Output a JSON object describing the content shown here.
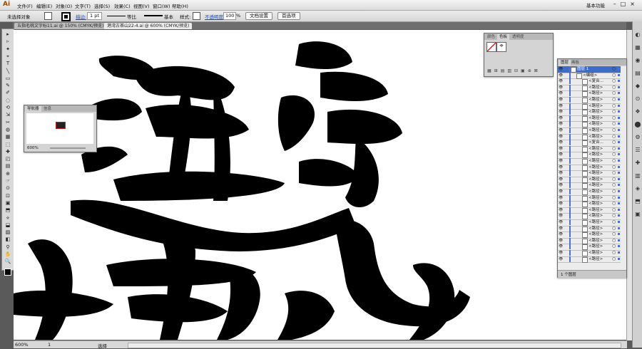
{
  "app": {
    "logo": "Ai",
    "workspace": "基本功能",
    "window_controls": [
      "–",
      "□",
      "×"
    ]
  },
  "menu": [
    "文件(F)",
    "编辑(E)",
    "对象(O)",
    "文字(T)",
    "选择(S)",
    "效果(C)",
    "视图(V)",
    "窗口(W)",
    "帮助(H)"
  ],
  "control_bar": {
    "selection": "未选择对象",
    "stroke_label": "描边:",
    "stroke_value": "1 pt",
    "profile_label": "等比",
    "brush_label": "基本",
    "style_label": "样式:",
    "opacity_label": "不透明度:",
    "opacity_value": "100",
    "opacity_unit": "%",
    "doc_setup": "文档设置",
    "preferences": "首选项"
  },
  "tabs": [
    {
      "label": "五指毛桃文字标11.ai @ 150% (CMYK/预览)",
      "active": false
    },
    {
      "label": "港湾古茶山22-4.ai @ 600% (CMYK/预览)",
      "active": true
    }
  ],
  "tools": [
    "▸",
    "▹",
    "✦",
    "⌖",
    "T",
    "╲",
    "▭",
    "✎",
    "✐",
    "◌",
    "⟲",
    "⇲",
    "✂",
    "◍",
    "▦",
    "⬚",
    "✚",
    "◰",
    "▤",
    "⊕",
    "☞",
    "⊙",
    "⊡",
    "▣",
    "⬒",
    "⟡",
    "⬓",
    "▨",
    "◧",
    "⚲",
    "✋",
    "🔍"
  ],
  "navigator": {
    "tabs": [
      "导航器",
      "信息"
    ],
    "zoom": "600%"
  },
  "color_panel": {
    "tabs": [
      "颜色",
      "色板",
      "透明度"
    ]
  },
  "layers": {
    "tabs": [
      "图层",
      "画板"
    ],
    "top_layer": "图层 1",
    "group": "<编组>",
    "items": [
      "<复合...",
      "<路径>",
      "<路径>",
      "<路径>",
      "<路径>",
      "<路径>",
      "<路径>",
      "<路径>",
      "<路径>",
      "<路径>",
      "<复合...",
      "<路径>",
      "<路径>",
      "<路径>",
      "<路径>",
      "<路径>",
      "<路径>",
      "<路径>",
      "<路径>",
      "<路径>",
      "<路径>",
      "<路径>",
      "<路径>",
      "<路径>",
      "<路径>",
      "<路径>",
      "<路径>",
      "<路径>",
      "<路径>",
      "<路径>"
    ],
    "count": "1 个图层"
  },
  "status": {
    "zoom": "600%",
    "page": "1",
    "mode": "选择"
  }
}
